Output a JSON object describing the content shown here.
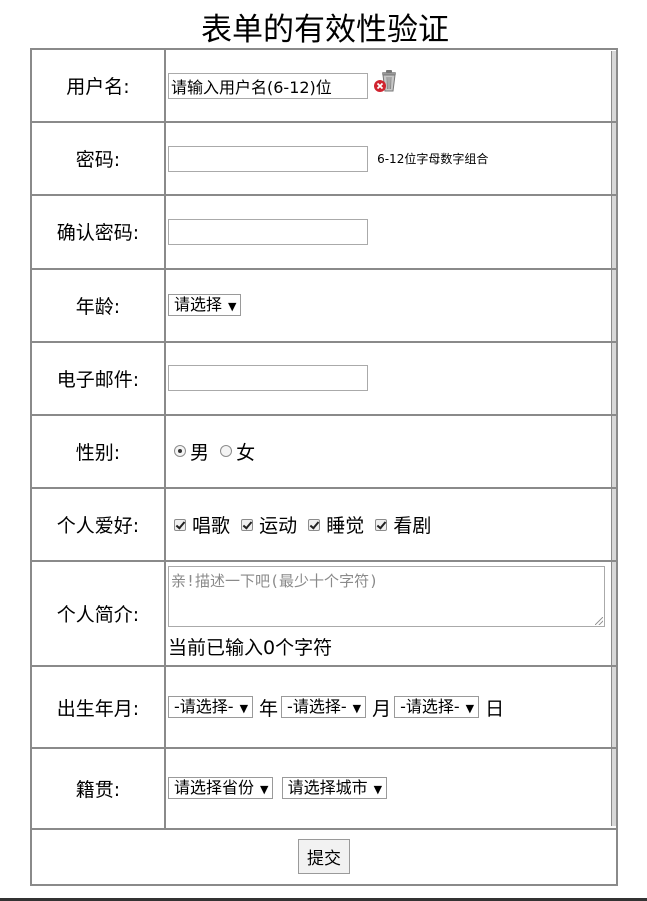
{
  "page": {
    "title": "表单的有效性验证"
  },
  "form": {
    "username": {
      "label": "用户名:",
      "value": "请输入用户名(6-12)位"
    },
    "password": {
      "label": "密码:",
      "value": "",
      "hint": "6-12位字母数字组合"
    },
    "confirm_password": {
      "label": "确认密码:",
      "value": ""
    },
    "age": {
      "label": "年龄:",
      "selected": "请选择"
    },
    "email": {
      "label": "电子邮件:",
      "value": ""
    },
    "gender": {
      "label": "性别:",
      "options": [
        {
          "label": "男",
          "checked": true
        },
        {
          "label": "女",
          "checked": false
        }
      ]
    },
    "hobbies": {
      "label": "个人爱好:",
      "options": [
        {
          "label": "唱歌",
          "checked": true
        },
        {
          "label": "运动",
          "checked": true
        },
        {
          "label": "睡觉",
          "checked": true
        },
        {
          "label": "看剧",
          "checked": true
        }
      ]
    },
    "bio": {
      "label": "个人简介:",
      "placeholder": "亲!描述一下吧(最少十个字符)",
      "counter": "当前已输入0个字符"
    },
    "birth": {
      "label": "出生年月:",
      "year_selected": "-请选择-",
      "year_unit": "年",
      "month_selected": "-请选择-",
      "month_unit": "月",
      "day_selected": "-请选择-",
      "day_unit": "日"
    },
    "hometown": {
      "label": "籍贯:",
      "province_selected": "请选择省份",
      "city_selected": "请选择城市"
    },
    "submit_label": "提交"
  }
}
